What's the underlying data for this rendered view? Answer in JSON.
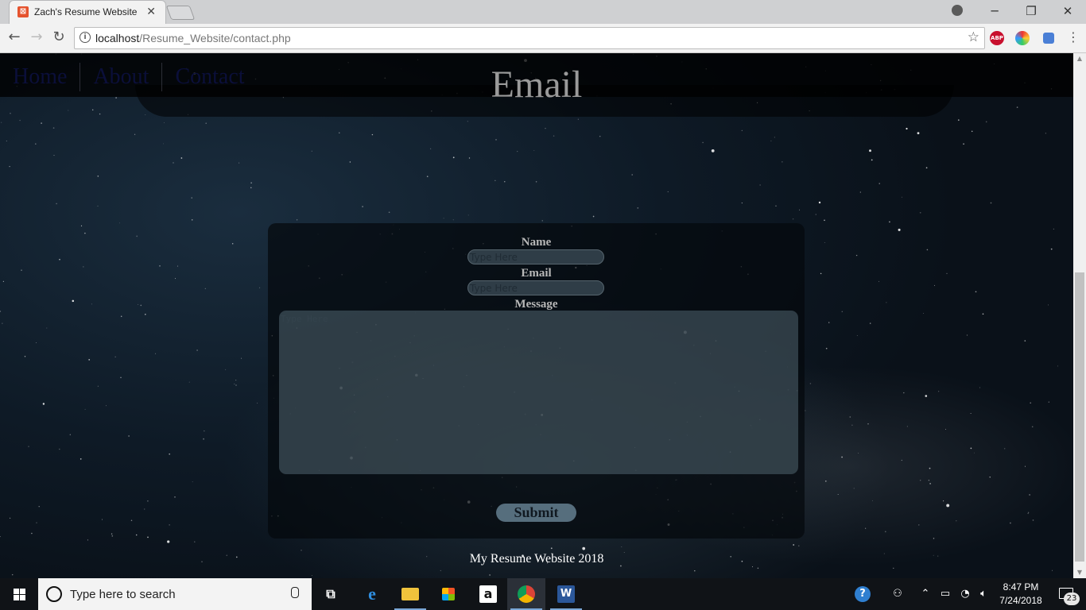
{
  "browser": {
    "tab_title": "Zach's Resume Website",
    "favicon": "xampp-icon",
    "url_host": "localhost",
    "url_path": "/Resume_Website/contact.php",
    "window_controls": [
      "minimize",
      "restore",
      "close"
    ],
    "extensions": [
      {
        "name": "abp-icon",
        "label": "ABP",
        "color": "#c8102e"
      },
      {
        "name": "colorzilla-icon",
        "label": "",
        "color": "#d1891d"
      },
      {
        "name": "pencil-extension-icon",
        "label": "",
        "color": "#4a7fd6"
      }
    ]
  },
  "site": {
    "nav": [
      "Home",
      "About",
      "Contact"
    ],
    "heading": "Email",
    "form": {
      "name_label": "Name",
      "name_placeholder": "Type Here",
      "email_label": "Email",
      "email_placeholder": "Type Here",
      "message_label": "Message",
      "message_placeholder": "Type Here",
      "submit_label": "Submit"
    },
    "footer": "My Resume Website 2018"
  },
  "taskbar": {
    "search_placeholder": "Type here to search",
    "apps": [
      "task-view",
      "edge",
      "file-explorer",
      "store",
      "amazon",
      "chrome",
      "word"
    ],
    "active_app": "chrome",
    "clock_time": "8:47 PM",
    "clock_date": "7/24/2018",
    "notification_count": "23"
  },
  "colors": {
    "accent_submit": "#566e7d",
    "heading_text": "#9a9a9a",
    "nav_text": "#0b0f3a"
  }
}
